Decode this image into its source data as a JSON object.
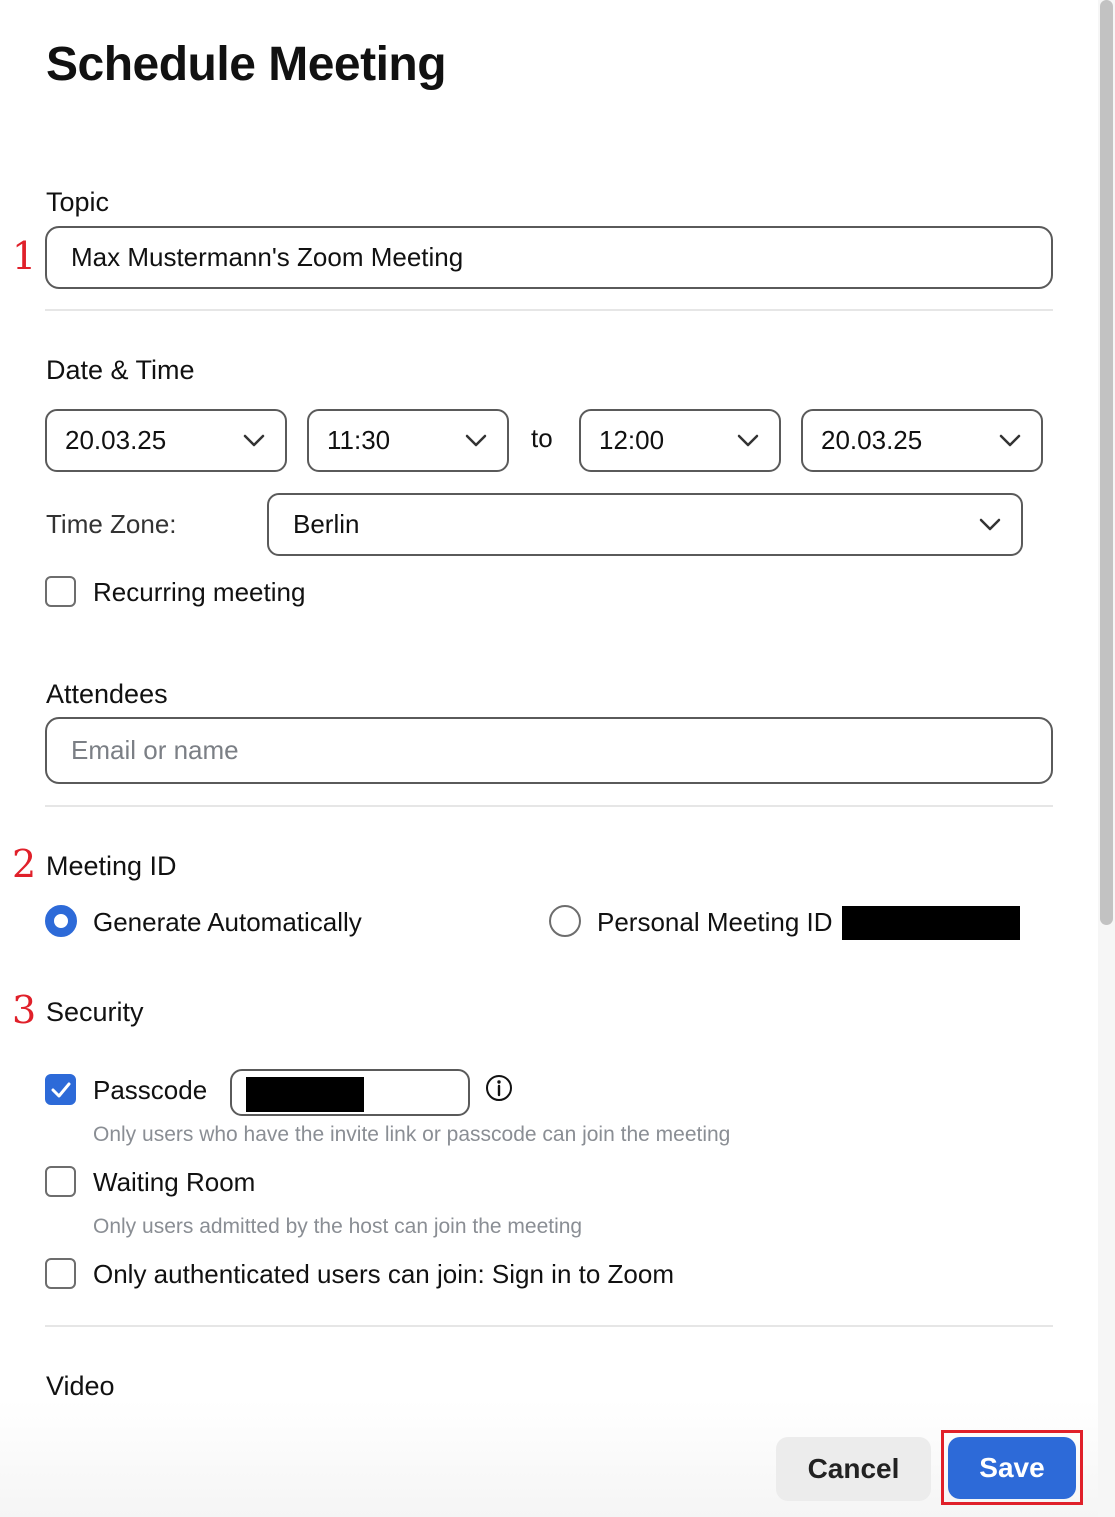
{
  "dialog": {
    "title": "Schedule Meeting"
  },
  "annotations": {
    "topic_marker": "1",
    "meeting_id_marker": "2",
    "security_marker": "3"
  },
  "topic": {
    "label": "Topic",
    "value": "Max Mustermann's Zoom Meeting"
  },
  "datetime": {
    "label": "Date & Time",
    "start_date": "20.03.25",
    "start_time": "11:30",
    "to_label": "to",
    "end_time": "12:00",
    "end_date": "20.03.25",
    "timezone_label": "Time Zone:",
    "timezone_value": "Berlin",
    "recurring_label": "Recurring meeting",
    "recurring_checked": false
  },
  "attendees": {
    "label": "Attendees",
    "placeholder": "Email or name"
  },
  "meeting_id": {
    "label": "Meeting ID",
    "option_auto": "Generate Automatically",
    "option_personal": "Personal Meeting ID",
    "selected": "auto"
  },
  "security": {
    "label": "Security",
    "passcode_label": "Passcode",
    "passcode_checked": true,
    "passcode_hint": "Only users who have the invite link or passcode can join the meeting",
    "waiting_room_label": "Waiting Room",
    "waiting_room_checked": false,
    "waiting_room_hint": "Only users admitted by the host can join the meeting",
    "auth_label": "Only authenticated users can join: Sign in to Zoom",
    "auth_checked": false
  },
  "video": {
    "label": "Video"
  },
  "footer": {
    "cancel_label": "Cancel",
    "save_label": "Save"
  },
  "colors": {
    "accent": "#2d6ad8",
    "annotation": "#e0202a"
  },
  "icons": {
    "chevron": "chevron-down-icon",
    "info": "info-icon",
    "check": "checkmark-icon"
  }
}
